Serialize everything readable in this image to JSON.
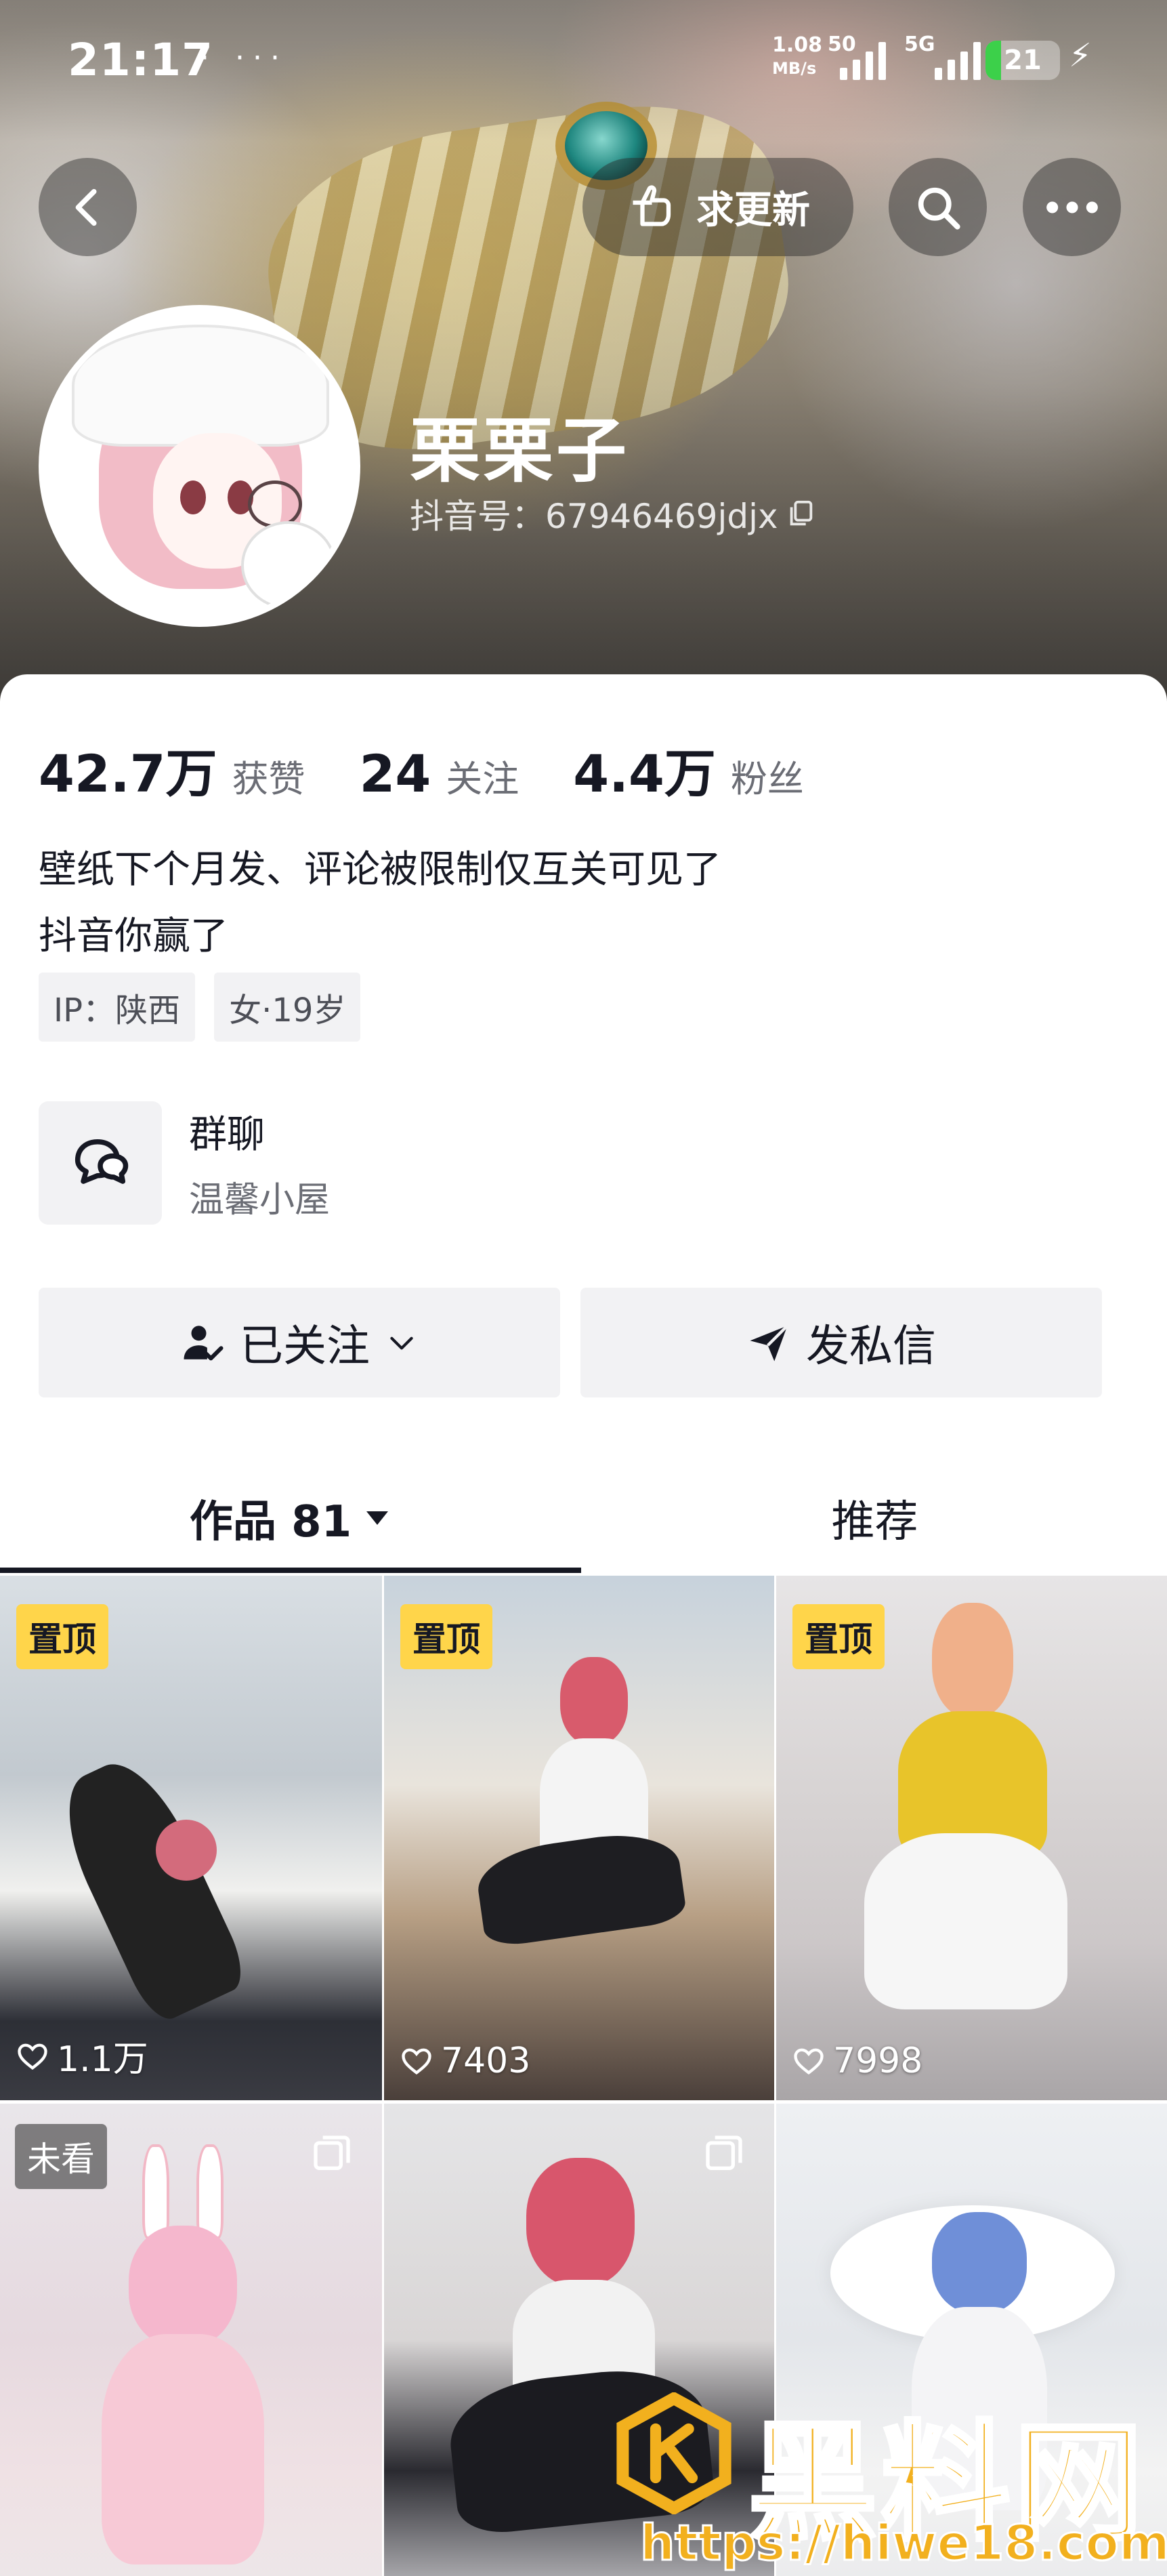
{
  "status_bar": {
    "time": "21:17",
    "dots": "· ···",
    "net_speed_value": "1.08",
    "net_speed_unit": "MB/s",
    "signal_extra": "50",
    "network_type": "5G",
    "battery": "21",
    "battery_level_percent": 21
  },
  "header": {
    "request_update_label": "求更新",
    "back_icon": "chevron-left-icon",
    "search_icon": "search-icon",
    "more_icon": "more-icon"
  },
  "profile": {
    "name": "栗栗子",
    "douyin_id": "抖音号：67946469jdjx"
  },
  "stats": [
    {
      "num": "42.7万",
      "label": "获赞"
    },
    {
      "num": "24",
      "label": "关注"
    },
    {
      "num": "4.4万",
      "label": "粉丝"
    }
  ],
  "bio": {
    "line1": "壁纸下个月发、评论被限制仅互关可见了",
    "line2": "抖音你赢了"
  },
  "tags": [
    "IP：陕西",
    "女·19岁"
  ],
  "group_chat": {
    "title": "群聊",
    "subtitle": "温馨小屋"
  },
  "actions": {
    "follow_label": "已关注",
    "message_label": "发私信"
  },
  "tabs": {
    "works": "作品 81",
    "recommend": "推荐"
  },
  "videos": [
    {
      "badge": "置顶",
      "likes": "1.1万"
    },
    {
      "badge": "置顶",
      "likes": "7403"
    },
    {
      "badge": "置顶",
      "likes": "7998"
    },
    {
      "badge": "未看",
      "likes": ""
    },
    {
      "badge": "",
      "likes": ""
    },
    {
      "badge": "",
      "likes": ""
    }
  ],
  "watermark": {
    "text": "黑料网",
    "url": "https://hiwe18.com"
  },
  "colors": {
    "accent_pin": "#ffd54a",
    "battery_green": "#3cd04a",
    "watermark": "#f2b01e"
  }
}
